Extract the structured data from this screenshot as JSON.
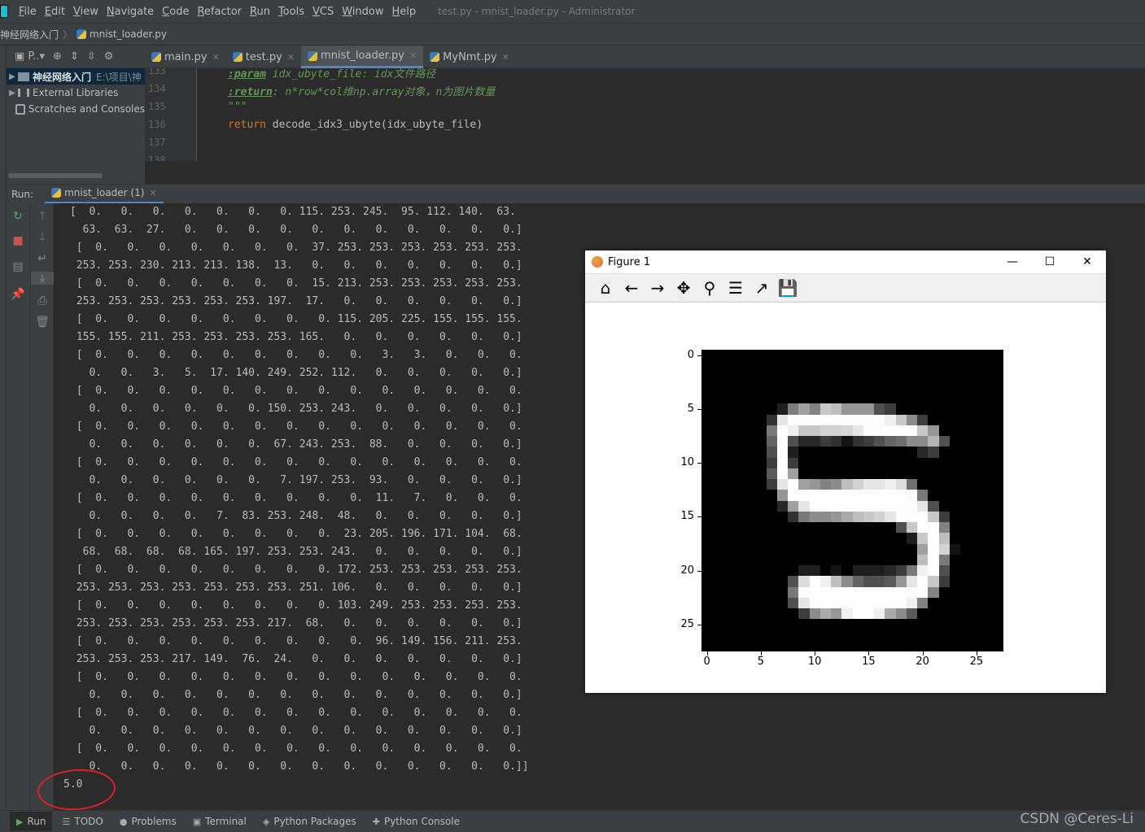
{
  "menu": [
    "File",
    "Edit",
    "View",
    "Navigate",
    "Code",
    "Refactor",
    "Run",
    "Tools",
    "VCS",
    "Window",
    "Help"
  ],
  "window_title": "test.py - mnist_loader.py - Administrator",
  "breadcrumb": {
    "project": "神经网络入门",
    "file": "mnist_loader.py"
  },
  "project_panel": {
    "toolbar_label": "P..▾",
    "root": {
      "name": "神经网络入门",
      "path": "E:\\项目\\神"
    },
    "items": [
      "External Libraries",
      "Scratches and Consoles"
    ]
  },
  "editor_tabs": [
    {
      "label": "main.py",
      "active": false
    },
    {
      "label": "test.py",
      "active": false
    },
    {
      "label": "mnist_loader.py",
      "active": true
    },
    {
      "label": "MyNmt.py",
      "active": false
    }
  ],
  "code_lines": [
    {
      "num": "133",
      "parts": [
        {
          "cls": "doctag",
          "text": ":param"
        },
        {
          "cls": "doc",
          "text": " idx_ubyte_file: idx文件路径"
        }
      ]
    },
    {
      "num": "134",
      "parts": [
        {
          "cls": "doctag",
          "text": ":return"
        },
        {
          "cls": "doc",
          "text": ": n*row*col维np.array对象，n为图片数量"
        }
      ]
    },
    {
      "num": "135",
      "parts": [
        {
          "cls": "doc",
          "text": "\"\"\""
        }
      ]
    },
    {
      "num": "136",
      "parts": [
        {
          "cls": "kw",
          "text": "return"
        },
        {
          "cls": "",
          "text": " decode_idx3_ubyte(idx_ubyte_file)"
        }
      ]
    },
    {
      "num": "137",
      "parts": []
    },
    {
      "num": "138",
      "parts": []
    }
  ],
  "run": {
    "label": "Run:",
    "tab": "mnist_loader (1)"
  },
  "console_lines": [
    "[  0.   0.   0.   0.   0.   0.   0. 115. 253. 245.  95. 112. 140.  63.",
    "  63.  63.  27.   0.   0.   0.   0.   0.   0.   0.   0.   0.   0.   0.]",
    " [  0.   0.   0.   0.   0.   0.   0.  37. 253. 253. 253. 253. 253. 253.",
    " 253. 253. 230. 213. 213. 138.  13.   0.   0.   0.   0.   0.   0.   0.]",
    " [  0.   0.   0.   0.   0.   0.   0.  15. 213. 253. 253. 253. 253. 253.",
    " 253. 253. 253. 253. 253. 253. 197.  17.   0.   0.   0.   0.   0.   0.]",
    " [  0.   0.   0.   0.   0.   0.   0.   0. 115. 205. 225. 155. 155. 155.",
    " 155. 155. 211. 253. 253. 253. 253. 165.   0.   0.   0.   0.   0.   0.]",
    " [  0.   0.   0.   0.   0.   0.   0.   0.   0.   3.   3.   0.   0.   0.",
    "   0.   0.   3.   5.  17. 140. 249. 252. 112.   0.   0.   0.   0.   0.]",
    " [  0.   0.   0.   0.   0.   0.   0.   0.   0.   0.   0.   0.   0.   0.",
    "   0.   0.   0.   0.   0.   0. 150. 253. 243.   0.   0.   0.   0.   0.]",
    " [  0.   0.   0.   0.   0.   0.   0.   0.   0.   0.   0.   0.   0.   0.",
    "   0.   0.   0.   0.   0.   0.  67. 243. 253.  88.   0.   0.   0.   0.]",
    " [  0.   0.   0.   0.   0.   0.   0.   0.   0.   0.   0.   0.   0.   0.",
    "   0.   0.   0.   0.   0.   0.   7. 197. 253.  93.   0.   0.   0.   0.]",
    " [  0.   0.   0.   0.   0.   0.   0.   0.   0.  11.   7.   0.   0.   0.",
    "   0.   0.   0.   0.   7.  83. 253. 248.  48.   0.   0.   0.   0.   0.]",
    " [  0.   0.   0.   0.   0.   0.   0.   0.  23. 205. 196. 171. 104.  68.",
    "  68.  68.  68.  68. 165. 197. 253. 253. 243.   0.   0.   0.   0.   0.]",
    " [  0.   0.   0.   0.   0.   0.   0.   0. 172. 253. 253. 253. 253. 253.",
    " 253. 253. 253. 253. 253. 253. 253. 251. 106.   0.   0.   0.   0.   0.]",
    " [  0.   0.   0.   0.   0.   0.   0.   0. 103. 249. 253. 253. 253. 253.",
    " 253. 253. 253. 253. 253. 253. 217.  68.   0.   0.   0.   0.   0.   0.]",
    " [  0.   0.   0.   0.   0.   0.   0.   0.   0.  96. 149. 156. 211. 253.",
    " 253. 253. 253. 217. 149.  76.  24.   0.   0.   0.   0.   0.   0.   0.]",
    " [  0.   0.   0.   0.   0.   0.   0.   0.   0.   0.   0.   0.   0.   0.",
    "   0.   0.   0.   0.   0.   0.   0.   0.   0.   0.   0.   0.   0.   0.]",
    " [  0.   0.   0.   0.   0.   0.   0.   0.   0.   0.   0.   0.   0.   0.",
    "   0.   0.   0.   0.   0.   0.   0.   0.   0.   0.   0.   0.   0.   0.]",
    " [  0.   0.   0.   0.   0.   0.   0.   0.   0.   0.   0.   0.   0.   0.",
    "   0.   0.   0.   0.   0.   0.   0.   0.   0.   0.   0.   0.   0.   0.]]"
  ],
  "console_result": "5.0",
  "status_tabs": [
    {
      "label": "Run",
      "icon": "run-icon",
      "active": true
    },
    {
      "label": "TODO",
      "icon": "list-icon",
      "active": false
    },
    {
      "label": "Problems",
      "icon": "info-icon",
      "active": false
    },
    {
      "label": "Terminal",
      "icon": "terminal-icon",
      "active": false
    },
    {
      "label": "Python Packages",
      "icon": "layers-icon",
      "active": false
    },
    {
      "label": "Python Console",
      "icon": "python-icon",
      "active": false
    }
  ],
  "watermark": "CSDN @Ceres-Li",
  "figure": {
    "title": "Figure 1",
    "toolbar": [
      "home-icon",
      "back-icon",
      "forward-icon",
      "pan-icon",
      "zoom-icon",
      "subplots-icon",
      "customize-icon",
      "save-icon"
    ],
    "y_ticks": [
      "0",
      "5",
      "10",
      "15",
      "20",
      "25"
    ],
    "x_ticks": [
      "0",
      "5",
      "10",
      "15",
      "20",
      "25"
    ]
  },
  "chart_data": {
    "type": "heatmap",
    "colormap": "gray",
    "xlim": [
      -0.5,
      27.5
    ],
    "ylim": [
      27.5,
      -0.5
    ],
    "x_ticks": [
      0,
      5,
      10,
      15,
      20,
      25
    ],
    "y_ticks": [
      0,
      5,
      10,
      15,
      20,
      25
    ],
    "rows": [
      [
        0,
        0,
        0,
        0,
        0,
        0,
        0,
        0,
        0,
        0,
        0,
        0,
        0,
        0,
        0,
        0,
        0,
        0,
        0,
        0,
        0,
        0,
        0,
        0,
        0,
        0,
        0,
        0
      ],
      [
        0,
        0,
        0,
        0,
        0,
        0,
        0,
        0,
        0,
        0,
        0,
        0,
        0,
        0,
        0,
        0,
        0,
        0,
        0,
        0,
        0,
        0,
        0,
        0,
        0,
        0,
        0,
        0
      ],
      [
        0,
        0,
        0,
        0,
        0,
        0,
        0,
        0,
        0,
        0,
        0,
        0,
        0,
        0,
        0,
        0,
        0,
        0,
        0,
        0,
        0,
        0,
        0,
        0,
        0,
        0,
        0,
        0
      ],
      [
        0,
        0,
        0,
        0,
        0,
        0,
        0,
        0,
        0,
        0,
        0,
        0,
        0,
        0,
        0,
        0,
        0,
        0,
        0,
        0,
        0,
        0,
        0,
        0,
        0,
        0,
        0,
        0
      ],
      [
        0,
        0,
        0,
        0,
        0,
        0,
        0,
        0,
        0,
        0,
        0,
        0,
        0,
        0,
        0,
        0,
        0,
        0,
        0,
        0,
        0,
        0,
        0,
        0,
        0,
        0,
        0,
        0
      ],
      [
        0,
        0,
        0,
        0,
        0,
        0,
        0,
        30,
        125,
        160,
        130,
        200,
        190,
        150,
        150,
        150,
        80,
        60,
        0,
        0,
        0,
        0,
        0,
        0,
        0,
        0,
        0,
        0
      ],
      [
        0,
        0,
        0,
        0,
        0,
        0,
        50,
        230,
        253,
        253,
        253,
        253,
        253,
        253,
        253,
        253,
        253,
        240,
        200,
        140,
        60,
        0,
        0,
        0,
        0,
        0,
        0,
        0
      ],
      [
        0,
        0,
        0,
        0,
        0,
        0,
        120,
        253,
        240,
        200,
        200,
        210,
        210,
        215,
        230,
        253,
        253,
        253,
        253,
        253,
        200,
        150,
        0,
        0,
        0,
        0,
        0,
        0
      ],
      [
        0,
        0,
        0,
        0,
        0,
        0,
        100,
        253,
        80,
        40,
        40,
        60,
        50,
        20,
        50,
        60,
        80,
        100,
        110,
        140,
        140,
        180,
        80,
        0,
        0,
        0,
        0,
        0
      ],
      [
        0,
        0,
        0,
        0,
        0,
        0,
        80,
        253,
        30,
        0,
        0,
        0,
        0,
        0,
        0,
        0,
        0,
        0,
        0,
        0,
        40,
        60,
        0,
        0,
        0,
        0,
        0,
        0
      ],
      [
        0,
        0,
        0,
        0,
        0,
        0,
        60,
        253,
        60,
        0,
        0,
        0,
        0,
        0,
        0,
        0,
        0,
        0,
        0,
        0,
        0,
        0,
        0,
        0,
        0,
        0,
        0,
        0
      ],
      [
        0,
        0,
        0,
        0,
        0,
        0,
        90,
        253,
        160,
        0,
        0,
        0,
        0,
        0,
        0,
        0,
        0,
        0,
        0,
        0,
        0,
        0,
        0,
        0,
        0,
        0,
        0,
        0
      ],
      [
        0,
        0,
        0,
        0,
        0,
        0,
        60,
        230,
        253,
        160,
        150,
        130,
        140,
        190,
        210,
        230,
        230,
        240,
        220,
        110,
        0,
        0,
        0,
        0,
        0,
        0,
        0,
        0
      ],
      [
        0,
        0,
        0,
        0,
        0,
        0,
        0,
        150,
        253,
        253,
        253,
        253,
        253,
        253,
        253,
        253,
        253,
        253,
        253,
        250,
        120,
        0,
        0,
        0,
        0,
        0,
        0,
        0
      ],
      [
        0,
        0,
        0,
        0,
        0,
        0,
        0,
        40,
        160,
        230,
        253,
        253,
        253,
        253,
        253,
        253,
        253,
        253,
        253,
        253,
        230,
        80,
        0,
        0,
        0,
        0,
        0,
        0
      ],
      [
        0,
        0,
        0,
        0,
        0,
        0,
        0,
        0,
        50,
        120,
        140,
        140,
        150,
        170,
        190,
        200,
        210,
        230,
        253,
        253,
        253,
        200,
        60,
        0,
        0,
        0,
        0,
        0
      ],
      [
        0,
        0,
        0,
        0,
        0,
        0,
        0,
        0,
        0,
        0,
        0,
        0,
        0,
        0,
        0,
        0,
        0,
        0,
        80,
        200,
        253,
        253,
        130,
        0,
        0,
        0,
        0,
        0
      ],
      [
        0,
        0,
        0,
        0,
        0,
        0,
        0,
        0,
        0,
        0,
        0,
        0,
        0,
        0,
        0,
        0,
        0,
        0,
        0,
        30,
        200,
        253,
        190,
        0,
        0,
        0,
        0,
        0
      ],
      [
        0,
        0,
        0,
        0,
        0,
        0,
        0,
        0,
        0,
        0,
        0,
        0,
        0,
        0,
        0,
        0,
        0,
        0,
        0,
        0,
        160,
        253,
        210,
        20,
        0,
        0,
        0,
        0
      ],
      [
        0,
        0,
        0,
        0,
        0,
        0,
        0,
        0,
        0,
        0,
        0,
        0,
        0,
        0,
        0,
        0,
        0,
        0,
        0,
        0,
        190,
        253,
        120,
        0,
        0,
        0,
        0,
        0
      ],
      [
        0,
        0,
        0,
        0,
        0,
        0,
        0,
        0,
        0,
        30,
        30,
        0,
        20,
        0,
        30,
        30,
        30,
        40,
        60,
        120,
        240,
        253,
        80,
        0,
        0,
        0,
        0,
        0
      ],
      [
        0,
        0,
        0,
        0,
        0,
        0,
        0,
        0,
        80,
        220,
        253,
        240,
        190,
        140,
        100,
        80,
        80,
        90,
        150,
        230,
        253,
        200,
        60,
        0,
        0,
        0,
        0,
        0
      ],
      [
        0,
        0,
        0,
        0,
        0,
        0,
        0,
        0,
        120,
        253,
        253,
        253,
        253,
        253,
        253,
        253,
        253,
        253,
        253,
        253,
        253,
        130,
        0,
        0,
        0,
        0,
        0,
        0
      ],
      [
        0,
        0,
        0,
        0,
        0,
        0,
        0,
        0,
        80,
        230,
        253,
        253,
        253,
        253,
        253,
        253,
        253,
        253,
        253,
        240,
        130,
        0,
        0,
        0,
        0,
        0,
        0,
        0
      ],
      [
        0,
        0,
        0,
        0,
        0,
        0,
        0,
        0,
        0,
        60,
        140,
        170,
        150,
        240,
        253,
        253,
        240,
        170,
        140,
        90,
        0,
        0,
        0,
        0,
        0,
        0,
        0,
        0
      ],
      [
        0,
        0,
        0,
        0,
        0,
        0,
        0,
        0,
        0,
        0,
        0,
        0,
        0,
        0,
        0,
        0,
        0,
        0,
        0,
        0,
        0,
        0,
        0,
        0,
        0,
        0,
        0,
        0
      ],
      [
        0,
        0,
        0,
        0,
        0,
        0,
        0,
        0,
        0,
        0,
        0,
        0,
        0,
        0,
        0,
        0,
        0,
        0,
        0,
        0,
        0,
        0,
        0,
        0,
        0,
        0,
        0,
        0
      ],
      [
        0,
        0,
        0,
        0,
        0,
        0,
        0,
        0,
        0,
        0,
        0,
        0,
        0,
        0,
        0,
        0,
        0,
        0,
        0,
        0,
        0,
        0,
        0,
        0,
        0,
        0,
        0,
        0
      ]
    ]
  }
}
